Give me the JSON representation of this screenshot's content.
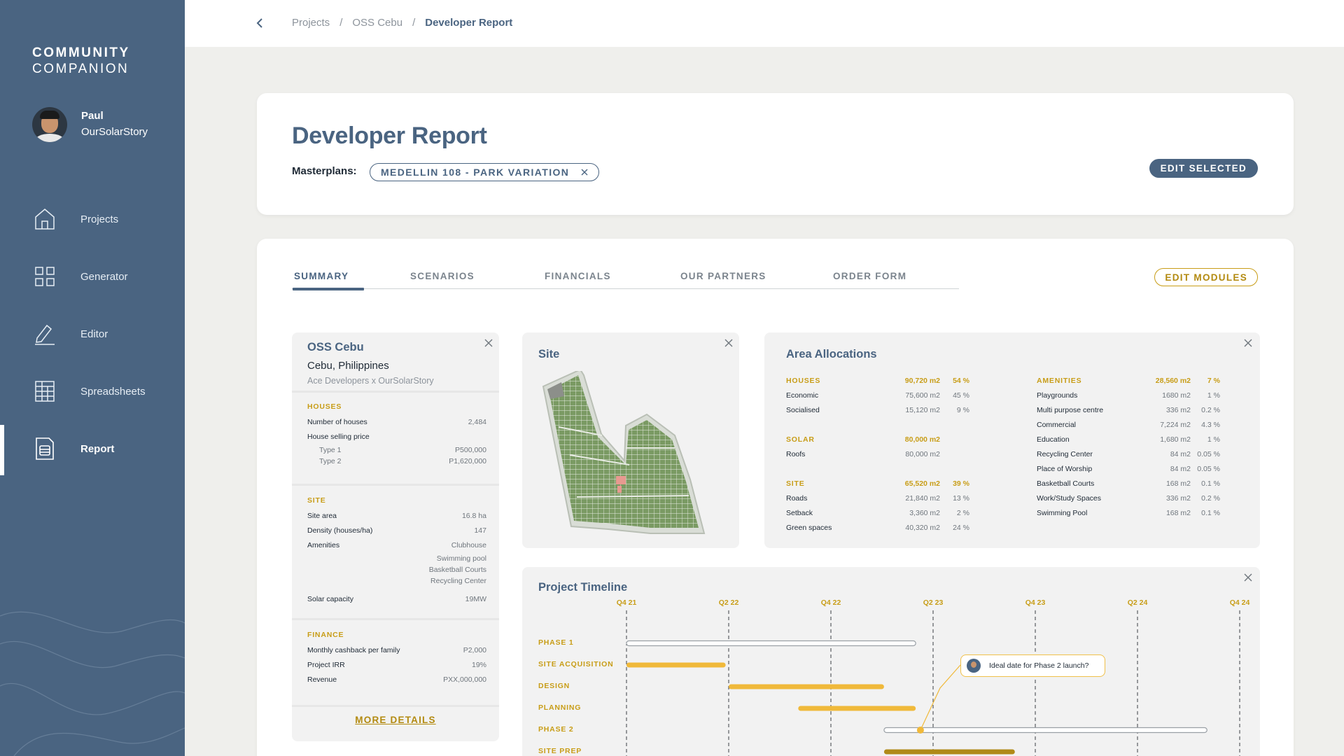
{
  "app": {
    "logo_line1": "COMMUNITY",
    "logo_line2": "COMPANION"
  },
  "user": {
    "name": "Paul",
    "org": "OurSolarStory"
  },
  "nav": [
    {
      "label": "Projects",
      "icon": "home-icon"
    },
    {
      "label": "Generator",
      "icon": "grid-icon"
    },
    {
      "label": "Editor",
      "icon": "pencil-icon"
    },
    {
      "label": "Spreadsheets",
      "icon": "spreadsheet-icon"
    },
    {
      "label": "Report",
      "icon": "report-icon",
      "active": true
    }
  ],
  "breadcrumb": {
    "items": [
      "Projects",
      "OSS Cebu",
      "Developer Report"
    ],
    "separator": "/"
  },
  "page": {
    "title": "Developer Report",
    "masterplans_label": "Masterplans:",
    "masterplan_chip": "MEDELLIN 108 - PARK VARIATION",
    "edit_selected": "EDIT SELECTED"
  },
  "tabs": [
    "SUMMARY",
    "SCENARIOS",
    "FINANCIALS",
    "OUR PARTNERS",
    "ORDER FORM"
  ],
  "edit_modules": "EDIT MODULES",
  "info": {
    "title": "OSS Cebu",
    "location": "Cebu, Philippines",
    "developer": "Ace Developers x OurSolarStory",
    "houses": {
      "title": "HOUSES",
      "rows": [
        {
          "k": "Number of houses",
          "v": "2,484"
        },
        {
          "k": "House selling price",
          "v": ""
        }
      ],
      "subrows": [
        {
          "k": "Type 1",
          "v": "P500,000"
        },
        {
          "k": "Type 2",
          "v": "P1,620,000"
        }
      ]
    },
    "site": {
      "title": "SITE",
      "rows": [
        {
          "k": "Site area",
          "v": "16.8 ha"
        },
        {
          "k": "Density (houses/ha)",
          "v": "147"
        },
        {
          "k": "Amenities",
          "v": "Clubhouse"
        }
      ],
      "amenities_more": [
        "Swimming pool",
        "Basketball Courts",
        "Recycling Center"
      ],
      "solar": {
        "k": "Solar capacity",
        "v": "19MW"
      }
    },
    "finance": {
      "title": "FINANCE",
      "rows": [
        {
          "k": "Monthly cashback per family",
          "v": "P2,000"
        },
        {
          "k": "Project IRR",
          "v": "19%"
        },
        {
          "k": "Revenue",
          "v": "PXX,000,000"
        }
      ]
    },
    "more_details": "MORE DETAILS"
  },
  "site_panel": {
    "title": "Site"
  },
  "area": {
    "title": "Area Allocations",
    "left": [
      {
        "head": true,
        "k": "HOUSES",
        "v1": "90,720 m2",
        "v2": "54 %"
      },
      {
        "k": "Economic",
        "v1": "75,600 m2",
        "v2": "45 %"
      },
      {
        "k": "Socialised",
        "v1": "15,120 m2",
        "v2": "9 %"
      },
      {
        "gap": true
      },
      {
        "head": true,
        "k": "SOLAR",
        "v1": "80,000 m2",
        "v2": ""
      },
      {
        "k": "Roofs",
        "v1": "80,000 m2",
        "v2": ""
      },
      {
        "gap": true
      },
      {
        "head": true,
        "k": "SITE",
        "v1": "65,520 m2",
        "v2": "39 %"
      },
      {
        "k": "Roads",
        "v1": "21,840 m2",
        "v2": "13 %"
      },
      {
        "k": "Setback",
        "v1": "3,360 m2",
        "v2": "2 %"
      },
      {
        "k": "Green spaces",
        "v1": "40,320 m2",
        "v2": "24 %"
      }
    ],
    "right": [
      {
        "head": true,
        "k": "AMENITIES",
        "v1": "28,560 m2",
        "v2": "7 %"
      },
      {
        "k": "Playgrounds",
        "v1": "1680 m2",
        "v2": "1 %"
      },
      {
        "k": "Multi purpose centre",
        "v1": "336 m2",
        "v2": "0.2 %"
      },
      {
        "k": "Commercial",
        "v1": "7,224 m2",
        "v2": "4.3 %"
      },
      {
        "k": "Education",
        "v1": "1,680 m2",
        "v2": "1 %"
      },
      {
        "k": "Recycling Center",
        "v1": "84 m2",
        "v2": "0.05 %"
      },
      {
        "k": "Place of Worship",
        "v1": "84 m2",
        "v2": "0.05 %"
      },
      {
        "k": "Basketball Courts",
        "v1": "168 m2",
        "v2": "0.1 %"
      },
      {
        "k": "Work/Study Spaces",
        "v1": "336 m2",
        "v2": "0.2 %"
      },
      {
        "k": "Swimming Pool",
        "v1": "168 m2",
        "v2": "0.1 %"
      }
    ]
  },
  "timeline": {
    "title": "Project Timeline",
    "quarters": [
      "Q4 21",
      "Q2 22",
      "Q4 22",
      "Q2 23",
      "Q4 23",
      "Q2 24",
      "Q4 24"
    ],
    "phases": [
      {
        "label": "PHASE 1",
        "start": 0,
        "end": 2.83,
        "style": "outline"
      },
      {
        "label": "SITE ACQUISITION",
        "start": 0,
        "end": 0.97,
        "style": "solid"
      },
      {
        "label": "DESIGN",
        "start": 1.0,
        "end": 2.52,
        "style": "solid"
      },
      {
        "label": "PLANNING",
        "start": 1.68,
        "end": 2.83,
        "style": "solid"
      },
      {
        "label": "PHASE 2",
        "start": 2.52,
        "end": 5.68,
        "style": "outline"
      },
      {
        "label": "SITE PREP",
        "start": 2.52,
        "end": 3.8,
        "style": "dark"
      }
    ],
    "comment": "Ideal date for Phase 2 launch?",
    "colors": {
      "gold": "#f0b93a",
      "dark_gold": "#b08a18",
      "outline": "#9aa0a6"
    }
  },
  "colors": {
    "primary": "#4a6481",
    "accent": "#c89d17",
    "background": "#efefec"
  }
}
